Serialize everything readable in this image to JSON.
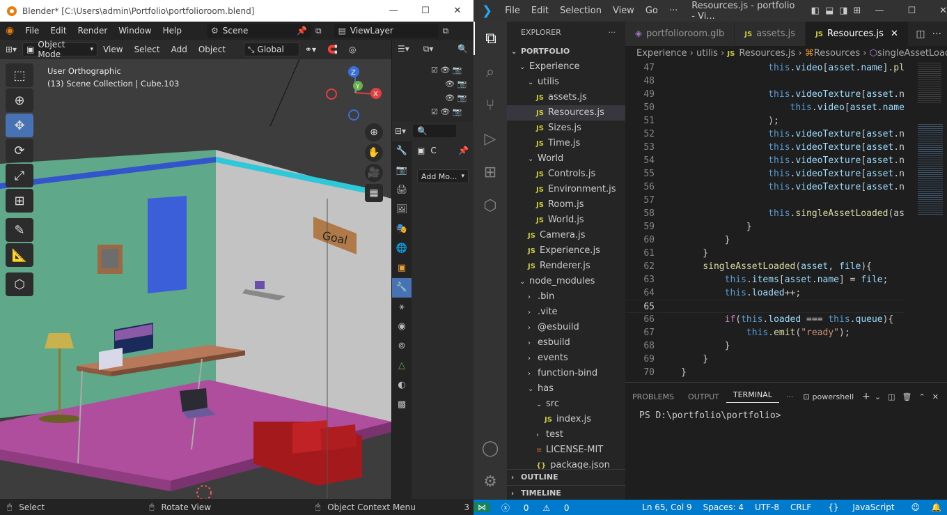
{
  "blender": {
    "title": "Blender* [C:\\Users\\admin\\Portfolio\\portfolioroom.blend]",
    "window_buttons": [
      "—",
      "☐",
      "✕"
    ],
    "menu": [
      "File",
      "Edit",
      "Render",
      "Window",
      "Help"
    ],
    "scene": "Scene",
    "view_layer": "ViewLayer",
    "header": {
      "mode": "Object Mode",
      "items": [
        "View",
        "Select",
        "Add",
        "Object"
      ],
      "transform": "Global"
    },
    "viewport": {
      "view_name": "User Orthographic",
      "collection": "(13) Scene Collection | Cube.103",
      "sign_text": "Goal"
    },
    "gizmo": {
      "z": "Z",
      "y": "Y",
      "x": "X"
    },
    "properties": {
      "tab_letter": "C",
      "add_modifier": "Add Mo..."
    },
    "status": {
      "select": "Select",
      "rotate": "Rotate View",
      "context": "Object Context Menu",
      "count": "3"
    }
  },
  "vscode": {
    "menu": [
      "File",
      "Edit",
      "Selection",
      "View",
      "Go",
      "···"
    ],
    "title": "Resources.js - portfolio - Vi...",
    "explorer_title": "EXPLORER",
    "root": "PORTFOLIO",
    "tree": [
      {
        "label": "Experience",
        "depth": 1,
        "kind": "folder-open"
      },
      {
        "label": "utilis",
        "depth": 2,
        "kind": "folder-open"
      },
      {
        "label": "assets.js",
        "depth": 3,
        "kind": "js"
      },
      {
        "label": "Resources.js",
        "depth": 3,
        "kind": "js",
        "selected": true
      },
      {
        "label": "Sizes.js",
        "depth": 3,
        "kind": "js"
      },
      {
        "label": "Time.js",
        "depth": 3,
        "kind": "js"
      },
      {
        "label": "World",
        "depth": 2,
        "kind": "folder-open"
      },
      {
        "label": "Controls.js",
        "depth": 3,
        "kind": "js"
      },
      {
        "label": "Environment.js",
        "depth": 3,
        "kind": "js"
      },
      {
        "label": "Room.js",
        "depth": 3,
        "kind": "js"
      },
      {
        "label": "World.js",
        "depth": 3,
        "kind": "js"
      },
      {
        "label": "Camera.js",
        "depth": 2,
        "kind": "js"
      },
      {
        "label": "Experience.js",
        "depth": 2,
        "kind": "js"
      },
      {
        "label": "Renderer.js",
        "depth": 2,
        "kind": "js"
      },
      {
        "label": "node_modules",
        "depth": 1,
        "kind": "folder-open"
      },
      {
        "label": ".bin",
        "depth": 2,
        "kind": "folder"
      },
      {
        "label": ".vite",
        "depth": 2,
        "kind": "folder"
      },
      {
        "label": "@esbuild",
        "depth": 2,
        "kind": "folder"
      },
      {
        "label": "esbuild",
        "depth": 2,
        "kind": "folder"
      },
      {
        "label": "events",
        "depth": 2,
        "kind": "folder"
      },
      {
        "label": "function-bind",
        "depth": 2,
        "kind": "folder"
      },
      {
        "label": "has",
        "depth": 2,
        "kind": "folder-open"
      },
      {
        "label": "src",
        "depth": 3,
        "kind": "folder-open"
      },
      {
        "label": "index.js",
        "depth": 4,
        "kind": "js"
      },
      {
        "label": "test",
        "depth": 3,
        "kind": "folder"
      },
      {
        "label": "LICENSE-MIT",
        "depth": 3,
        "kind": "file"
      },
      {
        "label": "package.json",
        "depth": 3,
        "kind": "json"
      }
    ],
    "outline": "OUTLINE",
    "timeline": "TIMELINE",
    "tabs": [
      {
        "label": "portfolioroom.glb",
        "icon": "3d-file-icon"
      },
      {
        "label": "assets.js",
        "icon": "js-file-icon"
      },
      {
        "label": "Resources.js",
        "icon": "js-file-icon",
        "active": true
      }
    ],
    "breadcrumbs": [
      "Experience",
      "utilis",
      "Resources.js",
      "Resources",
      "singleAssetLoaded"
    ],
    "code_lines": [
      {
        "n": "47",
        "t": "                this.video[asset.name].play"
      },
      {
        "n": "48",
        "t": ""
      },
      {
        "n": "49",
        "t": "                this.videoTexture[asset.nam"
      },
      {
        "n": "50",
        "t": "                    this.video[asset.name]"
      },
      {
        "n": "51",
        "t": "                );"
      },
      {
        "n": "52",
        "t": "                this.videoTexture[asset.nam"
      },
      {
        "n": "53",
        "t": "                this.videoTexture[asset.nam"
      },
      {
        "n": "54",
        "t": "                this.videoTexture[asset.nam"
      },
      {
        "n": "55",
        "t": "                this.videoTexture[asset.nam"
      },
      {
        "n": "56",
        "t": "                this.videoTexture[asset.nam"
      },
      {
        "n": "57",
        "t": ""
      },
      {
        "n": "58",
        "t": "                this.singleAssetLoaded(asse"
      },
      {
        "n": "59",
        "t": "            }"
      },
      {
        "n": "60",
        "t": "        }"
      },
      {
        "n": "61",
        "t": "    }"
      },
      {
        "n": "62",
        "t": "    singleAssetLoaded(asset, file){"
      },
      {
        "n": "63",
        "t": "        this.items[asset.name] = file;"
      },
      {
        "n": "64",
        "t": "        this.loaded++;"
      },
      {
        "n": "65",
        "t": ""
      },
      {
        "n": "66",
        "t": "        if(this.loaded === this.queue){"
      },
      {
        "n": "67",
        "t": "            this.emit(\"ready\");"
      },
      {
        "n": "68",
        "t": "        }"
      },
      {
        "n": "69",
        "t": "    }"
      },
      {
        "n": "70",
        "t": "}"
      }
    ],
    "panel_tabs": [
      "PROBLEMS",
      "OUTPUT",
      "TERMINAL"
    ],
    "terminal_shell": "powershell",
    "terminal_prompt": "PS D:\\portfolio\\portfolio>",
    "status": {
      "errors": "0",
      "warnings": "0",
      "position": "Ln 65, Col 9",
      "spaces": "Spaces: 4",
      "encoding": "UTF-8",
      "eol": "CRLF",
      "language": "JavaScript"
    }
  },
  "colors": {
    "vscode_accent": "#007acc",
    "blender_active": "#4772b3",
    "room_wall": "#5fa88a",
    "room_floor": "#b04e9e",
    "sofa": "#a3191c"
  }
}
